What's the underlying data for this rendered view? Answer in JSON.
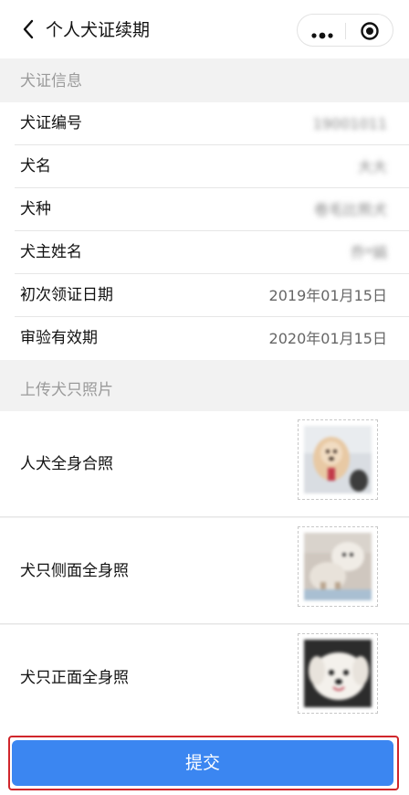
{
  "navbar": {
    "title": "个人犬证续期",
    "back_icon": "chevron-left-icon",
    "more_icon": "more-dots-icon",
    "close_icon": "target-close-icon"
  },
  "license_section": {
    "header": "犬证信息",
    "rows": [
      {
        "label": "犬证编号",
        "value": "19001011"
      },
      {
        "label": "犬名",
        "value": "大大"
      },
      {
        "label": "犬种",
        "value": "卷毛比熊犬"
      },
      {
        "label": "犬主姓名",
        "value": "乔*娟"
      },
      {
        "label": "初次领证日期",
        "value": "2019年01月15日"
      },
      {
        "label": "审验有效期",
        "value": "2020年01月15日"
      }
    ]
  },
  "photo_section": {
    "header": "上传犬只照片",
    "items": [
      {
        "label": "人犬全身合照"
      },
      {
        "label": "犬只侧面全身照"
      },
      {
        "label": "犬只正面全身照"
      }
    ]
  },
  "footer": {
    "submit_label": "提交"
  },
  "colors": {
    "accent": "#3b86f1",
    "highlight_border": "#d0262b"
  }
}
